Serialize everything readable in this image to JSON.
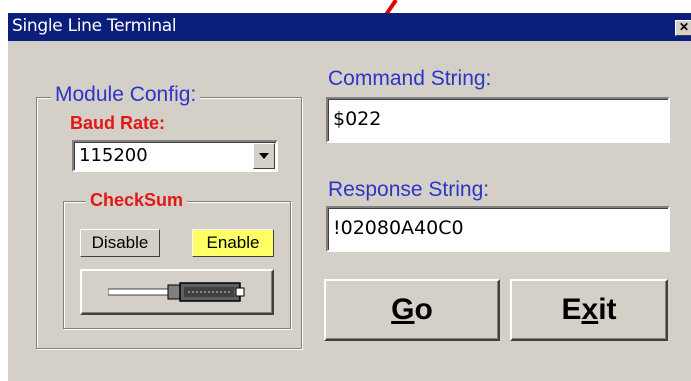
{
  "window": {
    "title": "Single Line Terminal",
    "close_glyph": "✕"
  },
  "module_config": {
    "label": "Module Config:",
    "baud_rate_label": "Baud Rate:",
    "baud_rate_value": "115200",
    "checksum": {
      "label": "CheckSum",
      "disable_label": "Disable",
      "enable_label": "Enable",
      "active": "Enable",
      "active_color": "#ffff66"
    }
  },
  "command": {
    "label": "Command String:",
    "value": "$022"
  },
  "response": {
    "label": "Response String:",
    "value": "!02080A40C0"
  },
  "buttons": {
    "go": {
      "mnemonic": "G",
      "rest": "o"
    },
    "exit": {
      "before": "E",
      "mnemonic": "x",
      "after": "it"
    }
  },
  "colors": {
    "label_blue": "#2b35c8",
    "label_red": "#e01818",
    "titlebar": "#0a1e7a",
    "annotation_line": "#e00000"
  }
}
